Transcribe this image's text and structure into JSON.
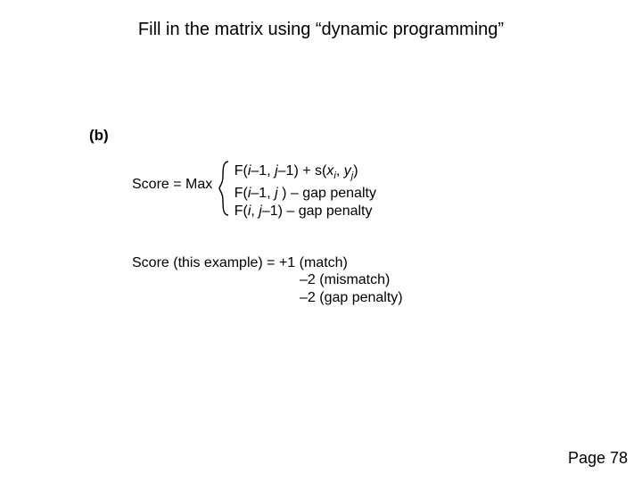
{
  "title": "Fill in the matrix using “dynamic programming”",
  "part_label": "(b)",
  "score": {
    "label": "Score = Max",
    "cases": {
      "c1_pre": "F(",
      "c1_i": "i",
      "c1_mid1": "–1, ",
      "c1_j": "j",
      "c1_mid2": "–1) + s(",
      "c1_x": "x",
      "c1_xi": "i",
      "c1_comma": ", ",
      "c1_y": "y",
      "c1_yj": "j",
      "c1_end": ")",
      "c2_pre": "F(",
      "c2_i": "i",
      "c2_mid1": "–1, ",
      "c2_j": "j",
      "c2_end": " ) – gap penalty",
      "c3_pre": "F(",
      "c3_i": "i",
      "c3_mid1": ", ",
      "c3_j": "j",
      "c3_end": "–1) – gap penalty"
    }
  },
  "example": {
    "line1": "Score (this example) = +1 (match)",
    "line2": "–2 (mismatch)",
    "line3": "–2 (gap penalty)"
  },
  "page_number": "Page 78"
}
